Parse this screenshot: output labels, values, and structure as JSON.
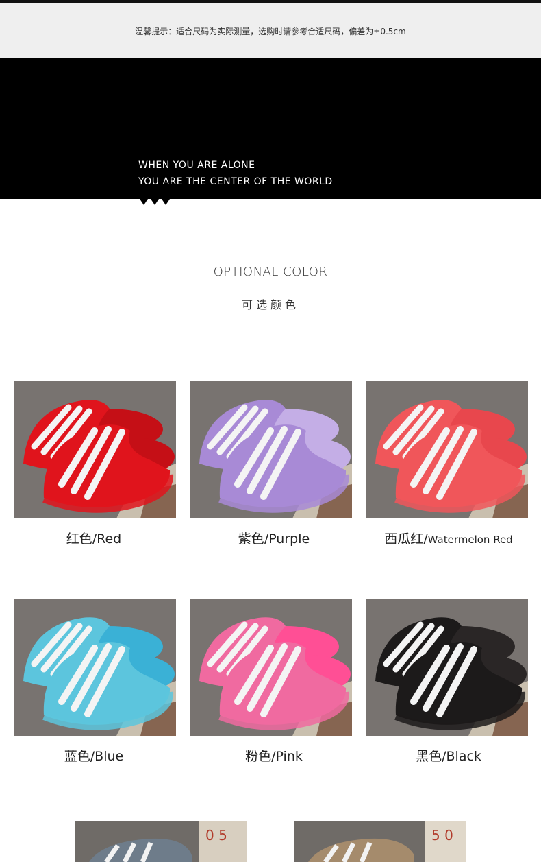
{
  "notice": "温馨提示：适合尺码为实际测量，选购时请参考合适尺码，偏差为±0.5cm",
  "banner": {
    "line1": "WHEN YOU ARE ALONE",
    "line2": "YOU ARE THE CENTER OF THE WORLD"
  },
  "section": {
    "title": "OPTIONAL COLOR",
    "subtitle": "可选颜色"
  },
  "colors": [
    {
      "cn": "红色/",
      "en": "Red",
      "hex": "#e0141c",
      "lining": "#c50f16"
    },
    {
      "cn": "紫色/",
      "en": "Purple",
      "hex": "#a88ad6",
      "lining": "#c4aee6"
    },
    {
      "cn": "西瓜红/",
      "en": "Watermelon Red",
      "hex": "#f0565a",
      "lining": "#e8474d"
    },
    {
      "cn": "蓝色/",
      "en": "Blue",
      "hex": "#5cc5dd",
      "lining": "#3ab1d6"
    },
    {
      "cn": "粉色/",
      "en": "Pink",
      "hex": "#f06aa0",
      "lining": "#ff4f95"
    },
    {
      "cn": "黑色/",
      "en": "Black",
      "hex": "#1c1a1a",
      "lining": "#2a2626"
    }
  ]
}
